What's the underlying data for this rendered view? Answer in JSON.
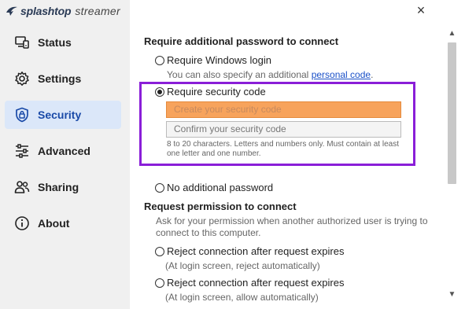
{
  "app": {
    "brand": "splashtop",
    "product": "streamer"
  },
  "window": {
    "close_symbol": "×"
  },
  "sidebar": {
    "items": [
      {
        "label": "Status",
        "icon": "status-icon",
        "active": false
      },
      {
        "label": "Settings",
        "icon": "gear-icon",
        "active": false
      },
      {
        "label": "Security",
        "icon": "shield-lock-icon",
        "active": true
      },
      {
        "label": "Advanced",
        "icon": "sliders-icon",
        "active": false
      },
      {
        "label": "Sharing",
        "icon": "users-icon",
        "active": false
      },
      {
        "label": "About",
        "icon": "info-icon",
        "active": false
      }
    ]
  },
  "password_section": {
    "title": "Require additional password to connect",
    "option_windows": "Require Windows login",
    "windows_hint_prefix": "You can also specify an additional ",
    "windows_hint_link": "personal code",
    "windows_hint_suffix": ".",
    "option_security_code": "Require security code",
    "create_placeholder": "Create your security code",
    "confirm_placeholder": "Confirm your security code",
    "code_hint": "8 to 20 characters. Letters and numbers only. Must contain at least one letter and one number.",
    "option_none": "No additional password"
  },
  "permission_section": {
    "title": "Request permission to connect",
    "description": "Ask for your permission when another authorized user is trying to connect to this computer.",
    "option_reject": "Reject connection after request expires",
    "option_reject_hint": "(At login screen, reject automatically)",
    "option_allow": "Reject connection after request expires",
    "option_allow_hint": "(At login screen, allow automatically)"
  },
  "colors": {
    "highlight": "#8a1ed8",
    "active_nav": "#dbe7f9",
    "link": "#1a50c8",
    "field_focus": "#f7a35c"
  }
}
